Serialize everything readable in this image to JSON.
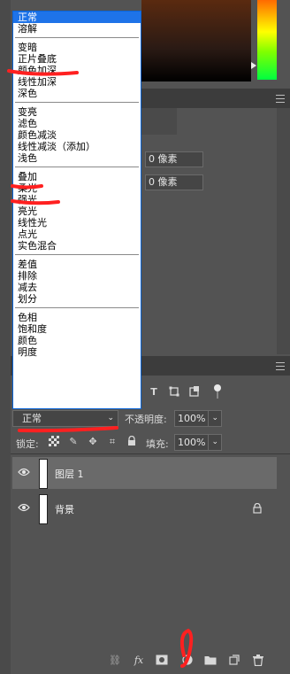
{
  "blend_modes": {
    "groups": [
      [
        "正常",
        "溶解"
      ],
      [
        "变暗",
        "正片叠底",
        "颜色加深",
        "线性加深",
        "深色"
      ],
      [
        "变亮",
        "滤色",
        "颜色减淡",
        "线性减淡（添加）",
        "浅色"
      ],
      [
        "叠加",
        "柔光",
        "强光",
        "亮光",
        "线性光",
        "点光",
        "实色混合"
      ],
      [
        "差值",
        "排除",
        "减去",
        "划分"
      ],
      [
        "色相",
        "饱和度",
        "颜色",
        "明度"
      ]
    ],
    "selected": "正常"
  },
  "properties": {
    "field1": "0 像素",
    "field2": "0 像素"
  },
  "layers_panel": {
    "blend_mode_value": "正常",
    "opacity_label": "不透明度:",
    "opacity_value": "100%",
    "lock_label": "锁定:",
    "fill_label": "填充:",
    "fill_value": "100%",
    "layers": [
      {
        "name": "图层 1",
        "selected": true
      },
      {
        "name": "背景",
        "selected": false,
        "locked": true
      }
    ]
  },
  "icons": [
    "eye-icon",
    "lock-icon",
    "link-icon",
    "fx-icon",
    "mask-icon",
    "adjustment-icon",
    "folder-icon",
    "new-layer-icon",
    "trash-icon",
    "filter-type-icon",
    "filter-shape-icon",
    "filter-smart-icon"
  ],
  "colors": {
    "selected_item": "#1e73e8",
    "annotation_red": "#ff2020"
  }
}
